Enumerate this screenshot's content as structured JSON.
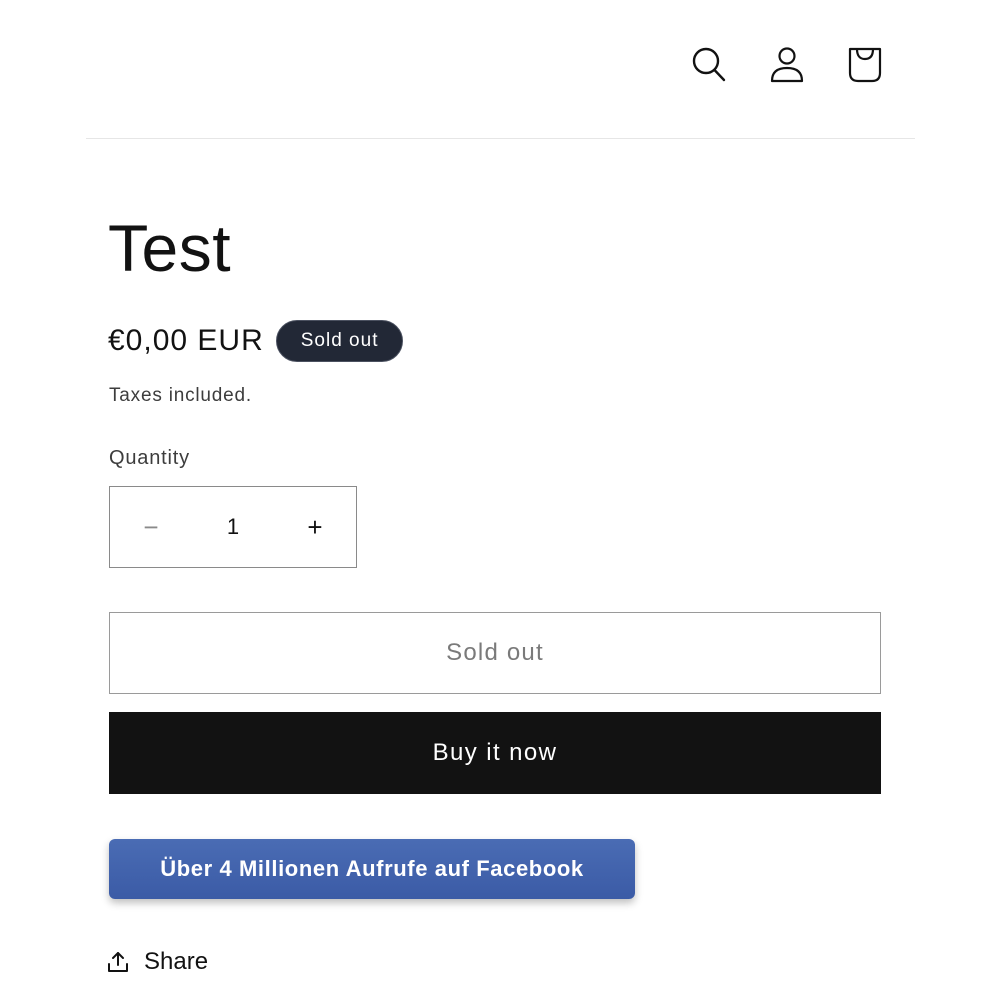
{
  "header": {
    "icons": [
      "search-icon",
      "account-icon",
      "cart-icon"
    ]
  },
  "product": {
    "title": "Test",
    "price": "€0,00 EUR",
    "badge": "Sold out",
    "taxes_note": "Taxes included.",
    "quantity_label": "Quantity",
    "quantity_value": "1",
    "quantity_minus": "−",
    "quantity_plus": "+",
    "sold_out_label": "Sold out",
    "buy_now_label": "Buy it now",
    "facebook_label": "Über 4 Millionen Aufrufe auf Facebook",
    "share_label": "Share"
  },
  "colors": {
    "badge_bg": "#222836",
    "buy_now_bg": "#121212",
    "facebook_blue": "#4a6cb4"
  }
}
